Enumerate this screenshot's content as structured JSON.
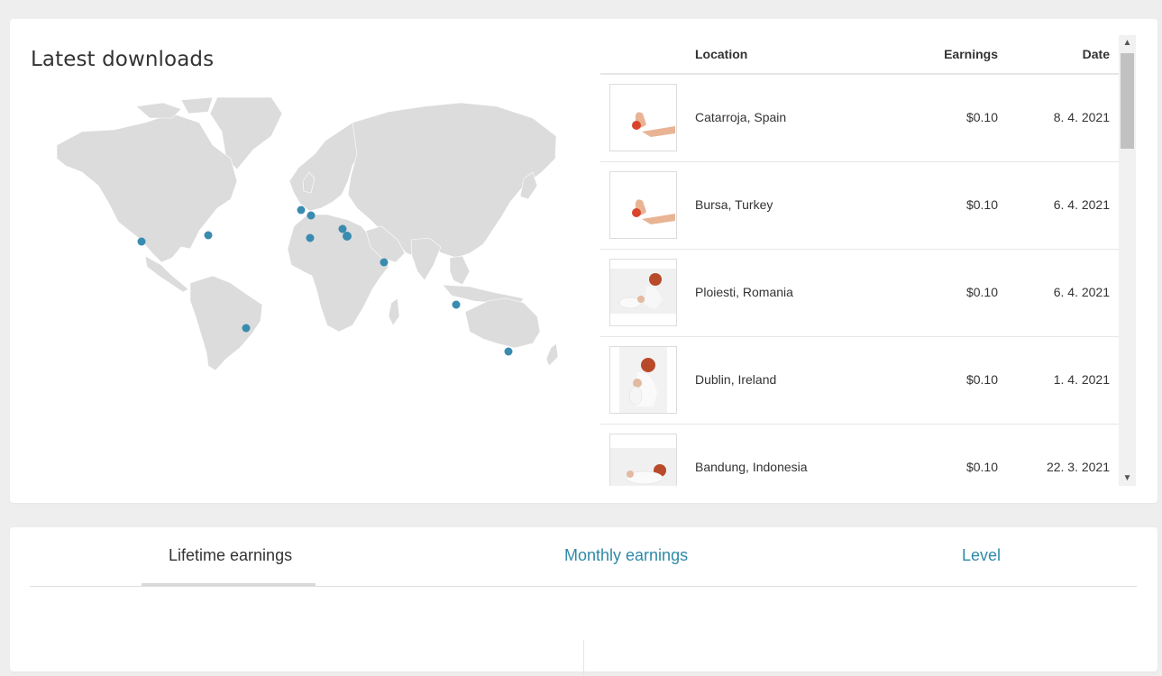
{
  "title": "Latest downloads",
  "table": {
    "headers": {
      "location": "Location",
      "earnings": "Earnings",
      "date": "Date"
    },
    "rows": [
      {
        "location": "Catarroja, Spain",
        "earnings": "$0.10",
        "date": "8. 4. 2021",
        "thumb": "hand-apple"
      },
      {
        "location": "Bursa, Turkey",
        "earnings": "$0.10",
        "date": "6. 4. 2021",
        "thumb": "hand-apple"
      },
      {
        "location": "Ploiesti, Romania",
        "earnings": "$0.10",
        "date": "6. 4. 2021",
        "thumb": "mother-baby"
      },
      {
        "location": "Dublin, Ireland",
        "earnings": "$0.10",
        "date": "1. 4. 2021",
        "thumb": "mother-baby-portrait"
      },
      {
        "location": "Bandung, Indonesia",
        "earnings": "$0.10",
        "date": "22. 3. 2021",
        "thumb": "mother-baby-lying"
      }
    ]
  },
  "tabs": {
    "lifetime": "Lifetime earnings",
    "monthly": "Monthly earnings",
    "level": "Level",
    "active": "lifetime"
  },
  "colors": {
    "accent": "#2e8aa6",
    "marker": "#3a8bb0",
    "land": "#dcdcdc"
  },
  "icons": {
    "scroll_up": "chevron-up-icon",
    "scroll_down": "chevron-down-icon"
  }
}
